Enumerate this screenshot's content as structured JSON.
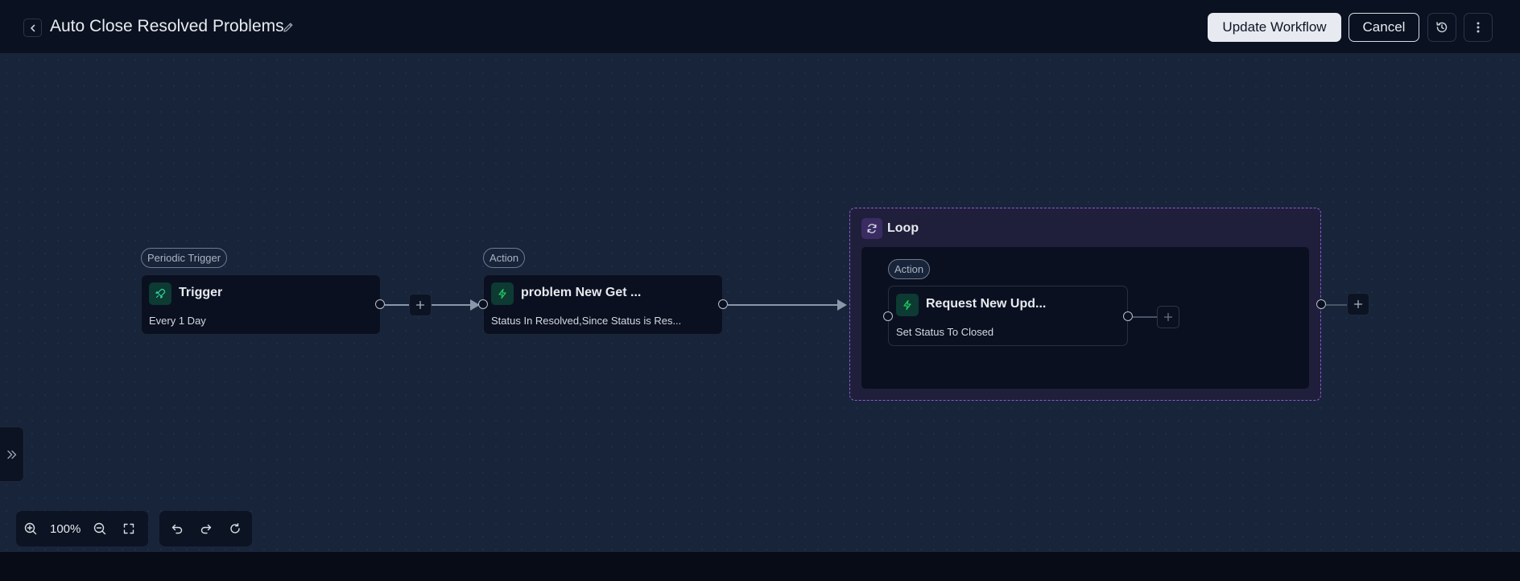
{
  "header": {
    "title": "Auto Close Resolved Problems",
    "update_label": "Update Workflow",
    "cancel_label": "Cancel",
    "icons": [
      "chevron-left-icon",
      "pencil-icon",
      "history-icon",
      "more-vertical-icon"
    ]
  },
  "nodes": {
    "trigger": {
      "chip": "Periodic Trigger",
      "title": "Trigger",
      "subtitle": "Every 1 Day",
      "icon": "rocket-icon"
    },
    "action1": {
      "chip": "Action",
      "title": "problem New Get ...",
      "subtitle": "Status In Resolved,Since Status is Res...",
      "icon": "bolt-icon"
    },
    "loop": {
      "title": "Loop",
      "icon": "refresh-icon"
    },
    "action2": {
      "chip": "Action",
      "title": "Request New Upd...",
      "subtitle": "Set Status To Closed",
      "icon": "bolt-icon"
    }
  },
  "toolbar": {
    "zoom": "100%"
  },
  "colors": {
    "accent_green": "#22c55e",
    "loop_border": "#8b5bd6",
    "canvas": "#18243a",
    "header": "#0a1120"
  }
}
